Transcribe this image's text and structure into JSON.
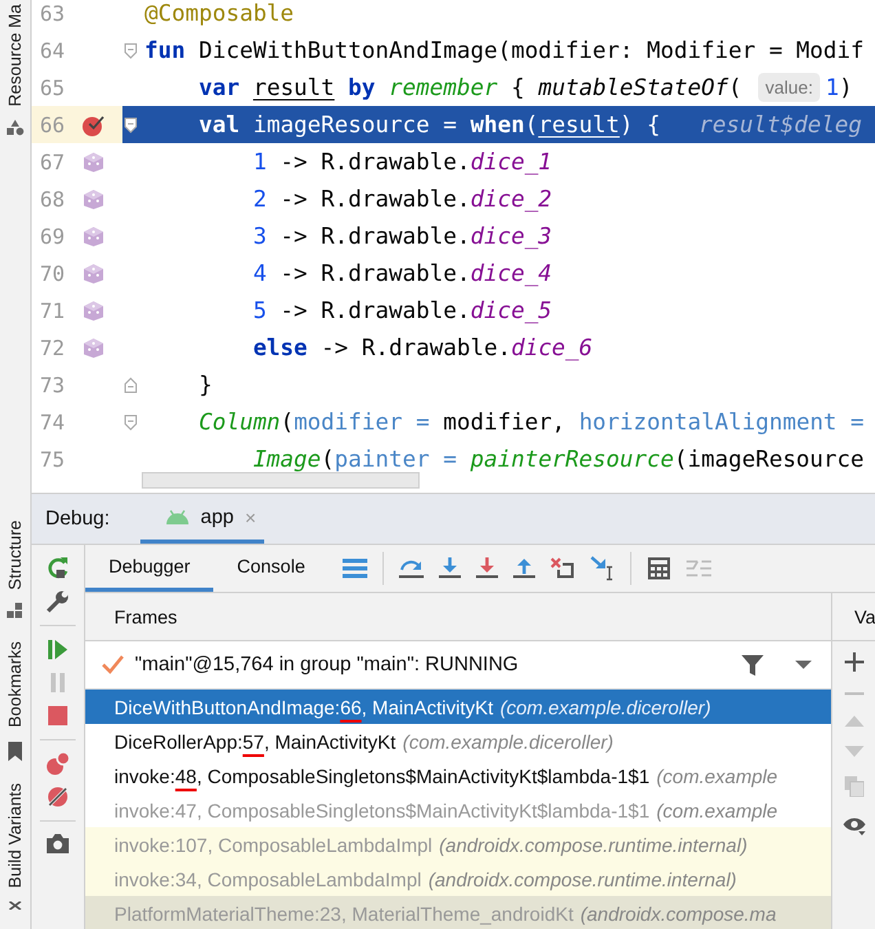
{
  "tool_strip": {
    "top": [
      {
        "label": "Resource Ma",
        "kind": "resources"
      }
    ],
    "bottom": [
      {
        "label": "Structure",
        "kind": "structure"
      },
      {
        "label": "Bookmarks",
        "kind": "bookmarks"
      },
      {
        "label": "Build Variants",
        "kind": "variants"
      }
    ]
  },
  "editor": {
    "lines": [
      {
        "number": "63",
        "selected": false,
        "tokens": [
          {
            "kind": "annot",
            "text": "@Composable"
          }
        ]
      },
      {
        "number": "64",
        "selected": false,
        "fold_start": true,
        "tokens": [
          {
            "kind": "kw",
            "text": "fun "
          },
          {
            "kind": "plain",
            "text": "DiceWithButtonAndImage(modifier: Modifier = Modif"
          }
        ]
      },
      {
        "number": "65",
        "selected": false,
        "tokens": [
          {
            "kind": "kw",
            "text": "    var "
          },
          {
            "kind": "ref",
            "text": "result"
          },
          {
            "kind": "kw",
            "text": " by "
          },
          {
            "kind": "call",
            "text": "remember"
          },
          {
            "kind": "plain",
            "text": " { "
          },
          {
            "kind": "italic",
            "text": "mutableStateOf"
          },
          {
            "kind": "plain",
            "text": "("
          },
          {
            "kind": "hint",
            "text": "value:"
          },
          {
            "kind": "num",
            "text": "1"
          },
          {
            "kind": "plain",
            "text": ")"
          }
        ]
      },
      {
        "number": "66",
        "selected": true,
        "breakpoint": true,
        "fold_start": true,
        "tokens": [
          {
            "kind": "kw",
            "text": "    val "
          },
          {
            "kind": "plain",
            "text": "imageResource = "
          },
          {
            "kind": "kw",
            "text": "when"
          },
          {
            "kind": "plain",
            "text": "("
          },
          {
            "kind": "ref",
            "text": "result"
          },
          {
            "kind": "plain",
            "text": ") {"
          },
          {
            "kind": "value-hint",
            "text": "result$deleg"
          }
        ]
      },
      {
        "number": "67",
        "selected": false,
        "dice_icon": true,
        "tokens": [
          {
            "kind": "num",
            "text": "        1"
          },
          {
            "kind": "plain",
            "text": " -> R.drawable."
          },
          {
            "kind": "field",
            "text": "dice_1"
          }
        ]
      },
      {
        "number": "68",
        "selected": false,
        "dice_icon": true,
        "tokens": [
          {
            "kind": "num",
            "text": "        2"
          },
          {
            "kind": "plain",
            "text": " -> R.drawable."
          },
          {
            "kind": "field",
            "text": "dice_2"
          }
        ]
      },
      {
        "number": "69",
        "selected": false,
        "dice_icon": true,
        "tokens": [
          {
            "kind": "num",
            "text": "        3"
          },
          {
            "kind": "plain",
            "text": " -> R.drawable."
          },
          {
            "kind": "field",
            "text": "dice_3"
          }
        ]
      },
      {
        "number": "70",
        "selected": false,
        "dice_icon": true,
        "tokens": [
          {
            "kind": "num",
            "text": "        4"
          },
          {
            "kind": "plain",
            "text": " -> R.drawable."
          },
          {
            "kind": "field",
            "text": "dice_4"
          }
        ]
      },
      {
        "number": "71",
        "selected": false,
        "dice_icon": true,
        "tokens": [
          {
            "kind": "num",
            "text": "        5"
          },
          {
            "kind": "plain",
            "text": " -> R.drawable."
          },
          {
            "kind": "field",
            "text": "dice_5"
          }
        ]
      },
      {
        "number": "72",
        "selected": false,
        "dice_icon": true,
        "tokens": [
          {
            "kind": "kw",
            "text": "        else"
          },
          {
            "kind": "plain",
            "text": " -> R.drawable."
          },
          {
            "kind": "field",
            "text": "dice_6"
          }
        ]
      },
      {
        "number": "73",
        "selected": false,
        "fold_end": true,
        "tokens": [
          {
            "kind": "plain",
            "text": "    }"
          }
        ]
      },
      {
        "number": "74",
        "selected": false,
        "fold_start": true,
        "tokens": [
          {
            "kind": "call",
            "text": "    Column"
          },
          {
            "kind": "plain",
            "text": "("
          },
          {
            "kind": "param",
            "text": "modifier ="
          },
          {
            "kind": "plain",
            "text": " modifier, "
          },
          {
            "kind": "param",
            "text": "horizontalAlignment ="
          }
        ]
      },
      {
        "number": "75",
        "selected": false,
        "tokens": [
          {
            "kind": "call",
            "text": "        Image"
          },
          {
            "kind": "plain",
            "text": "("
          },
          {
            "kind": "param",
            "text": "painter ="
          },
          {
            "kind": "call",
            "text": " painterResource"
          },
          {
            "kind": "plain",
            "text": "(imageResource"
          }
        ]
      }
    ]
  },
  "debug": {
    "title": "Debug:",
    "session_tab": {
      "label": "app",
      "close": "×"
    },
    "tabs": [
      {
        "label": "Debugger",
        "selected": true
      },
      {
        "label": "Console",
        "selected": false
      }
    ],
    "frames_header": "Frames",
    "variables_header": "Va",
    "thread": "\"main\"@15,764 in group \"main\": RUNNING",
    "frames": [
      {
        "method": "DiceWithButtonAndImage:",
        "line": "66",
        "rest": ", MainActivityKt",
        "package": "(com.example.diceroller)",
        "kind": "app",
        "selected": true,
        "underlined": true
      },
      {
        "method": "DiceRollerApp:",
        "line": "57",
        "rest": ", MainActivityKt",
        "package": "(com.example.diceroller)",
        "kind": "app",
        "selected": false,
        "underlined": true
      },
      {
        "method": "invoke:",
        "line": "48",
        "rest": ", ComposableSingletons$MainActivityKt$lambda-1$1",
        "package": "(com.example",
        "kind": "app",
        "selected": false,
        "underlined": true
      },
      {
        "method": "invoke:",
        "line": "47",
        "rest": ", ComposableSingletons$MainActivityKt$lambda-1$1",
        "package": "(com.example",
        "kind": "synthetic",
        "selected": false,
        "underlined": false
      },
      {
        "method": "invoke:",
        "line": "107",
        "rest": ", ComposableLambdaImpl",
        "package": "(androidx.compose.runtime.internal)",
        "kind": "library",
        "selected": false,
        "underlined": false
      },
      {
        "method": "invoke:",
        "line": "34",
        "rest": ", ComposableLambdaImpl",
        "package": "(androidx.compose.runtime.internal)",
        "kind": "library",
        "selected": false,
        "underlined": false
      },
      {
        "method": "PlatformMaterialTheme:",
        "line": "23",
        "rest": ", MaterialTheme_androidKt",
        "package": "(androidx.compose.ma",
        "kind": "async",
        "selected": false,
        "underlined": false
      }
    ]
  }
}
